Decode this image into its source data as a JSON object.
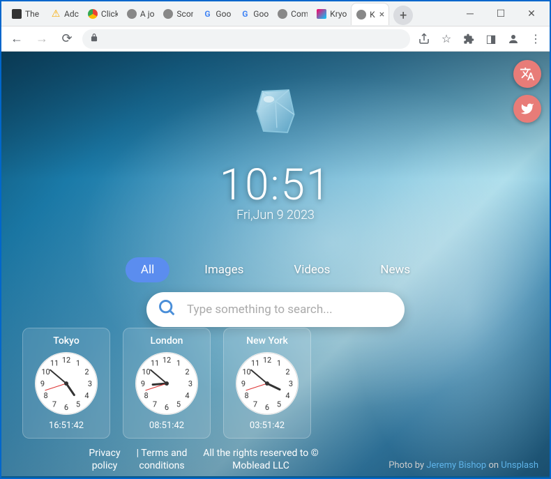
{
  "window": {
    "tabs": [
      {
        "label": "The I",
        "icon": "dark"
      },
      {
        "label": "Adc",
        "icon": "warn"
      },
      {
        "label": "Click",
        "icon": "chrome"
      },
      {
        "label": "A jo",
        "icon": "globe"
      },
      {
        "label": "Scor",
        "icon": "globe"
      },
      {
        "label": "Goo",
        "icon": "google"
      },
      {
        "label": "Goo",
        "icon": "google"
      },
      {
        "label": "Com",
        "icon": "globe"
      },
      {
        "label": "Kryo",
        "icon": "color"
      },
      {
        "label": "K",
        "icon": "globe",
        "active": true
      }
    ]
  },
  "main": {
    "time": "10:51",
    "date": "Fri,Jun 9 2023",
    "categories": [
      "All",
      "Images",
      "Videos",
      "News"
    ],
    "active_category": 0,
    "search_placeholder": "Type something to search..."
  },
  "clocks": [
    {
      "city": "Tokyo",
      "digital": "16:51:42",
      "h": 16,
      "m": 51,
      "s": 42
    },
    {
      "city": "London",
      "digital": "08:51:42",
      "h": 8,
      "m": 51,
      "s": 42
    },
    {
      "city": "New York",
      "digital": "03:51:42",
      "h": 3,
      "m": 51,
      "s": 42
    }
  ],
  "footer": {
    "privacy": "Privacy policy",
    "terms": "| Terms and conditions",
    "rights": "All the rights reserved to © Moblead LLC",
    "photo_by": "Photo by ",
    "author": "Jeremy Bishop",
    "on": " on ",
    "source": "Unsplash"
  }
}
